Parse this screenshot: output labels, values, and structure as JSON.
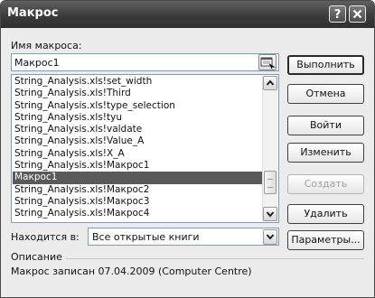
{
  "window": {
    "title": "Макрос",
    "help_label": "?",
    "close_label": "✕"
  },
  "macro_name": {
    "label": "Имя макроса:",
    "value": "Макрос1"
  },
  "macro_list": {
    "items": [
      "String_Analysis.xls!set_width",
      "String_Analysis.xls!Third",
      "String_Analysis.xls!type_selection",
      "String_Analysis.xls!tyu",
      "String_Analysis.xls!valdate",
      "String_Analysis.xls!Value_A",
      "String_Analysis.xls!X_A",
      "String_Analysis.xls!Макрос1",
      "Макрос1",
      "String_Analysis.xls!Макрос2",
      "String_Analysis.xls!Макрос3",
      "String_Analysis.xls!Макрос4"
    ],
    "selected_index": 8
  },
  "buttons": {
    "run": "Выполнить",
    "cancel": "Отмена",
    "step_into": "Войти",
    "edit": "Изменить",
    "create": "Создать",
    "delete": "Удалить",
    "options": "Параметры..."
  },
  "location": {
    "label": "Находится в:",
    "value": "Все открытые книги"
  },
  "description": {
    "label": "Описание",
    "text": "Макрос записан 07.04.2009 (Computer Centre)"
  },
  "icons": {
    "scroll_up": "scroll-up-arrow-icon",
    "scroll_down": "scroll-down-arrow-icon",
    "dropdown": "chevron-down-icon",
    "collapse": "collapse-dialog-icon"
  }
}
